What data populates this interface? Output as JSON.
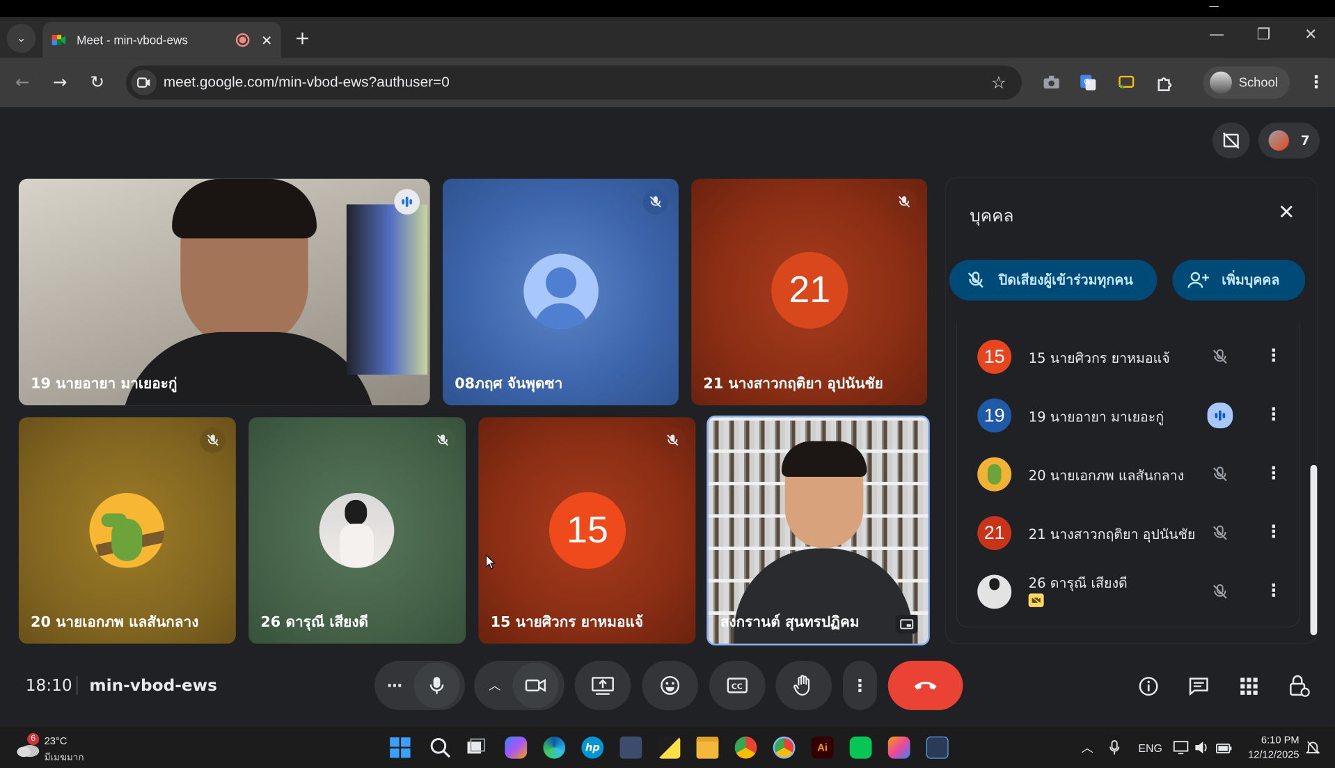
{
  "browser": {
    "tab_title": "Meet - min-vbod-ews",
    "url": "meet.google.com/min-vbod-ews?authuser=0",
    "profile_label": "School"
  },
  "meet": {
    "participant_count": "7",
    "clock": "18:10",
    "meeting_code": "min-vbod-ews",
    "tiles": [
      {
        "name": "19 นายอายา มาเยอะกู่"
      },
      {
        "name": "08ภฤศ จันพุดซา"
      },
      {
        "name": "21 นางสาวกฤติยา อุปนันชัย",
        "avatar_text": "21"
      },
      {
        "name": "20 นายเอกภพ แลสันกลาง"
      },
      {
        "name": "26 ดารุณี เสียงดี"
      },
      {
        "name": "15 นายศิวกร ยาหมอแจ้",
        "avatar_text": "15"
      },
      {
        "name": "สงกรานต์ สุนทรปฏิคม"
      }
    ]
  },
  "people_panel": {
    "title": "บุคคล",
    "mute_all_label": "ปิดเสียงผู้เข้าร่วมทุกคน",
    "add_people_label": "เพิ่มบุคคล",
    "rows": [
      {
        "avatar": "15",
        "name": "15 นายศิวกร ยาหมอแจ้",
        "color": "#e8451e"
      },
      {
        "avatar": "19",
        "name": "19 นายอายา มาเยอะกู่",
        "color": "#1e5aa8"
      },
      {
        "avatar": "",
        "name": "20 นายเอกภพ แลสันกลาง",
        "color": "#f2b234"
      },
      {
        "avatar": "21",
        "name": "21 นางสาวกฤติยา อุปนันชัย",
        "color": "#c8331a"
      },
      {
        "avatar": "",
        "name": "26 ดารุณี เสียงดี",
        "color": "#d8d8d8"
      }
    ]
  },
  "taskbar": {
    "weather_temp": "23°C",
    "weather_desc": "มีเมฆมาก",
    "weather_badge": "6",
    "lang": "ENG",
    "time": "6:10 PM",
    "date": "12/12/2025"
  }
}
